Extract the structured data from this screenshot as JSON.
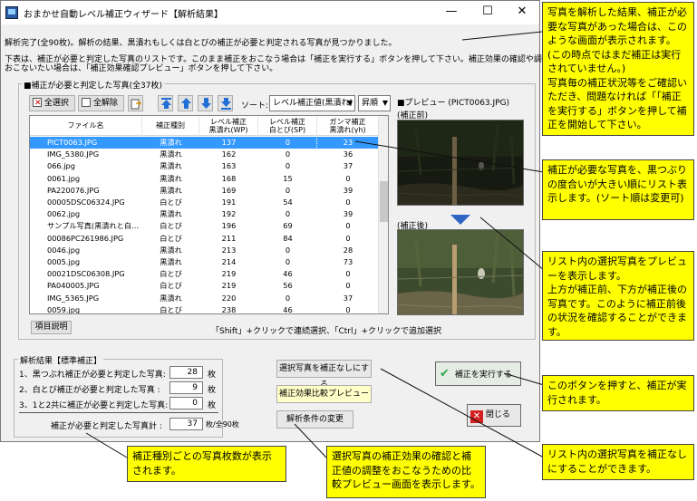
{
  "window": {
    "title": "おまかせ自動レベル補正ウィザード【解析結果】",
    "minimize_symbol": "—",
    "maximize_symbol": "☐",
    "close_symbol": "✕"
  },
  "messages": {
    "line1": "解析完了(全90枚)。解析の結果、黒潰れもしくは白とびの補正が必要と判定される写真が見つかりました。",
    "line2": "下表は、補正が必要と判定した写真のリストです。このまま補正をおこなう場合は「補正を実行する」ボタンを押して下さい。補正効果の確認や調整を",
    "line3": "おこないたい場合は、「補正効果確認プレビュー」ボタンを押して下さい。"
  },
  "list_group": {
    "label": "■補正が必要と判定した写真(全37枚)",
    "select_all": "全選択",
    "deselect_all": "全解除",
    "sort_label": "ソート:",
    "sort_value": "レベル補正値(黒潰れ)",
    "order_value": "昇順",
    "preview_label": "■プレビュー (PICT0063.JPG)",
    "preview_before": "(補正前)",
    "preview_after": "(補正後)",
    "columns": {
      "filename": "ファイル名",
      "type": "補正種別",
      "wp": "レベル補正\n黒潰れ(WP)",
      "sp": "レベル補正\n白とび(SP)",
      "gamma": "ガンマ補正\n黒潰れ(γh)"
    },
    "rows": [
      {
        "file": "PICT0063.JPG",
        "type": "黒潰れ",
        "wp": "137",
        "sp": "0",
        "gamma": "23",
        "selected": true
      },
      {
        "file": "IMG_5380.JPG",
        "type": "黒潰れ",
        "wp": "162",
        "sp": "0",
        "gamma": "36",
        "selected": false
      },
      {
        "file": "066.jpg",
        "type": "黒潰れ",
        "wp": "163",
        "sp": "0",
        "gamma": "37",
        "selected": false
      },
      {
        "file": "0061.jpg",
        "type": "黒潰れ",
        "wp": "168",
        "sp": "15",
        "gamma": "0",
        "selected": false
      },
      {
        "file": "PA220076.JPG",
        "type": "黒潰れ",
        "wp": "169",
        "sp": "0",
        "gamma": "39",
        "selected": false
      },
      {
        "file": "00005DSC06324.JPG",
        "type": "白とび",
        "wp": "191",
        "sp": "54",
        "gamma": "0",
        "selected": false
      },
      {
        "file": "0062.jpg",
        "type": "黒潰れ",
        "wp": "192",
        "sp": "0",
        "gamma": "39",
        "selected": false
      },
      {
        "file": "サンプル写真(黒潰れと白…",
        "type": "白とび",
        "wp": "196",
        "sp": "69",
        "gamma": "0",
        "selected": false
      },
      {
        "file": "00086PC261986.JPG",
        "type": "白とび",
        "wp": "211",
        "sp": "84",
        "gamma": "0",
        "selected": false
      },
      {
        "file": "0046.jpg",
        "type": "黒潰れ",
        "wp": "213",
        "sp": "0",
        "gamma": "28",
        "selected": false
      },
      {
        "file": "0005.jpg",
        "type": "黒潰れ",
        "wp": "214",
        "sp": "0",
        "gamma": "73",
        "selected": false
      },
      {
        "file": "00021DSC06308.JPG",
        "type": "白とび",
        "wp": "219",
        "sp": "46",
        "gamma": "0",
        "selected": false
      },
      {
        "file": "PA040005.JPG",
        "type": "白とび",
        "wp": "219",
        "sp": "56",
        "gamma": "0",
        "selected": false
      },
      {
        "file": "IMG_5365.JPG",
        "type": "黒潰れ",
        "wp": "220",
        "sp": "0",
        "gamma": "37",
        "selected": false
      },
      {
        "file": "0059.jpg",
        "type": "白とび",
        "wp": "238",
        "sp": "46",
        "gamma": "0",
        "selected": false
      }
    ],
    "item_help": "項目説明",
    "hint": "「Shift」+クリックで連続選択、「Ctrl」+クリックで追加選択"
  },
  "results": {
    "label": "解析結果【標準補正】",
    "r1_label": "1、黒つぶれ補正が必要と判定した写真:",
    "r1_value": "28",
    "r2_label": "2、白とび補正が必要と判定した写真 :",
    "r2_value": "9",
    "r3_label": "3、1と2共に補正が必要と判定した写真:",
    "r3_value": "0",
    "unit": "枚",
    "total_label": "補正が必要と判定した写真計 :",
    "total_value": "37",
    "total_suffix": "枚/全90枚"
  },
  "actions": {
    "no_correction": "選択写真を補正なしにする",
    "compare_preview": "補正効果比較プレビュー",
    "change_conditions": "解析条件の変更",
    "execute": "補正を実行する",
    "close": "閉じる"
  },
  "callouts": {
    "c1": "写真を解析した結果、補正が必要な写真があった場合は、このような画面が表示されます。(この時点ではまだ補正は実行されていません。)\n写真毎の補正状況等をご確認いただき、問題なければ「「補正を実行する」ボタンを押して補正を開始して下さい。",
    "c2": "補正が必要な写真を、黒つぶりの度合いが大きい順にリスト表示します。(ソート順は変更可)",
    "c3": "リスト内の選択写真をプレビューを表示します。\n上方が補正前、下方が補正後の写真です。このように補正前後の状況を確認することができます。",
    "c4": "このボタンを押すと、補正が実行されます。",
    "c5": "補正種別ごとの写真枚数が表示されます。",
    "c6": "選択写真の補正効果の確認と補正値の調整をおこなうための比較プレビュー画面を表示します。",
    "c7": "リスト内の選択写真を補正なしにすることができます。"
  },
  "colors": {
    "callout_bg": "#ffff00",
    "selection": "#3399ff",
    "arrow_blue": "#1f6fd6",
    "execute_green": "#2fa84f",
    "close_red": "#d42020"
  },
  "icons": {
    "app": "app-icon",
    "select_all": "select-all-icon",
    "deselect_all": "deselect-all-icon",
    "export": "export-icon",
    "move_top": "move-top-icon",
    "move_up": "move-up-icon",
    "move_down": "move-down-icon",
    "move_bottom": "move-bottom-icon",
    "check": "check-icon",
    "close_x": "close-x-icon"
  }
}
